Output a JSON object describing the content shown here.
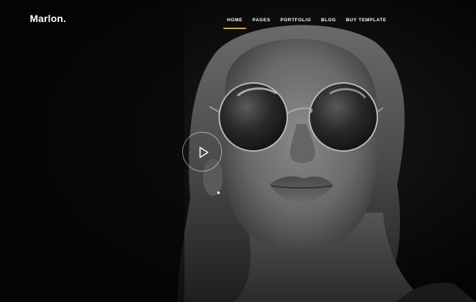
{
  "brand": {
    "logo_text": "Marlon."
  },
  "nav": {
    "items": [
      {
        "label": "HOME",
        "active": true
      },
      {
        "label": "PAGES",
        "active": false
      },
      {
        "label": "PORTFOLIO",
        "active": false
      },
      {
        "label": "BLOG",
        "active": false
      },
      {
        "label": "BUY TEMPLATE",
        "active": false
      }
    ]
  },
  "hero": {
    "image_description_icon": "portrait-image",
    "accent_color": "#e0a82e",
    "play_icon": "play-icon"
  }
}
